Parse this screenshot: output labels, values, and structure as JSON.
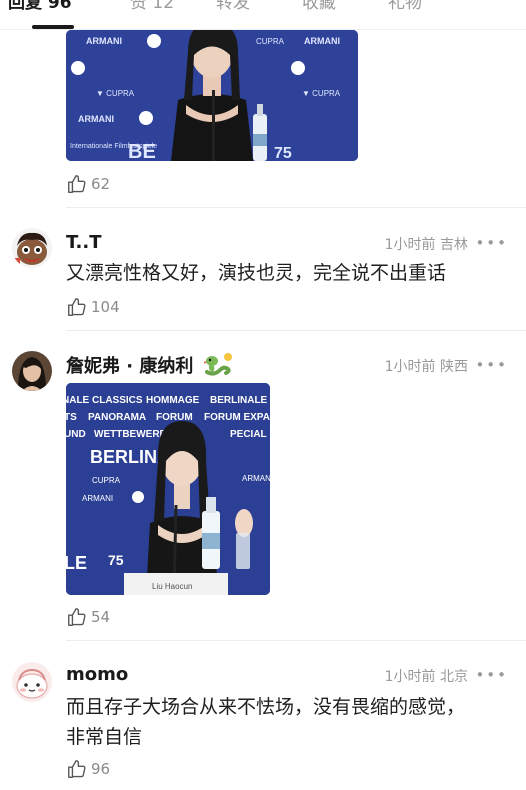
{
  "tabs": [
    {
      "label": "回复 96",
      "active": true
    },
    {
      "label": "赞 12",
      "active": false
    },
    {
      "label": "转发",
      "active": false
    },
    {
      "label": "收藏",
      "active": false
    },
    {
      "label": "礼物",
      "active": false
    }
  ],
  "comments": [
    {
      "like_count": "62",
      "photo": {
        "texts": [
          "ARMANI",
          "CUPRA",
          "ARMANI",
          "ARMANI",
          "Internationale Filmfestspiele",
          "BE",
          "75"
        ]
      }
    },
    {
      "username": "T..T",
      "time": "1小时前",
      "location": "吉林",
      "more": "•••",
      "content": "又漂亮性格又好，演技也灵，完全说不出重话",
      "like_count": "104"
    },
    {
      "username": "詹妮弗 · 康纳利",
      "badge_icon": "snake-emoji-icon",
      "time": "1小时前",
      "location": "陕西",
      "more": "•••",
      "like_count": "54",
      "photo": {
        "texts": [
          "NALE CLASSICS",
          "HOMMAGE",
          "BERLINALE G",
          "TS",
          "PANORAMA",
          "FORUM",
          "FORUM EXPAN",
          "UND",
          "WETTBEWERB",
          "BE",
          "PECIAL",
          "BERLINALE",
          "ARMANI",
          "CUPRA",
          "ARMANI",
          "LE",
          "75",
          "Liu Haocun"
        ]
      }
    },
    {
      "username": "momo",
      "time": "1小时前",
      "location": "北京",
      "more": "•••",
      "content": "而且存子大场合从来不怯场，没有畏缩的感觉，非常自信",
      "like_count": "96"
    }
  ],
  "colors": {
    "backdrop_blue": "#2c3f93",
    "text_gray": "#9a9a9a"
  }
}
